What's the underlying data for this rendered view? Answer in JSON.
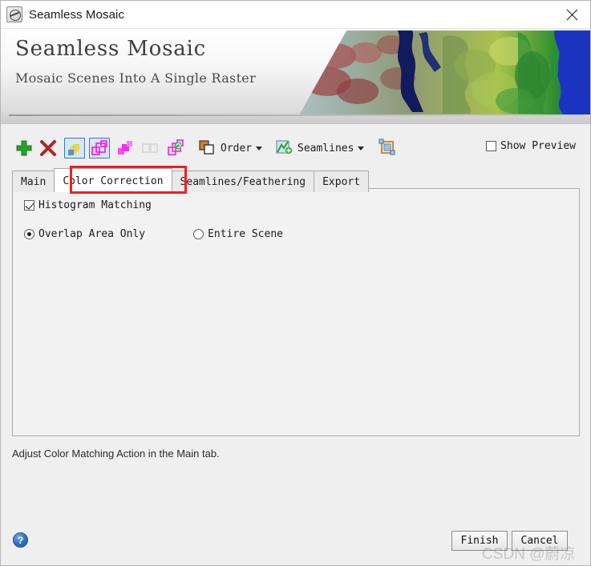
{
  "window": {
    "title": "Seamless Mosaic",
    "app_icon": "seamless-mosaic-app-icon",
    "close_icon": "close-icon"
  },
  "banner": {
    "title": "Seamless Mosaic",
    "subtitle": "Mosaic Scenes Into A Single Raster",
    "image_alt": "satellite-false-color-mosaic"
  },
  "toolbar": {
    "items": [
      {
        "name": "add-scenes-button",
        "icon": "plus-icon",
        "label": "",
        "toggled": false
      },
      {
        "name": "remove-scenes-button",
        "icon": "red-x-icon",
        "label": "",
        "toggled": false
      },
      {
        "name": "show-image-button",
        "icon": "color-image-icon",
        "label": "",
        "toggled": true
      },
      {
        "name": "show-footprints-button",
        "icon": "magenta-outline-frames-icon",
        "label": "",
        "toggled": true
      },
      {
        "name": "show-overlaps-button",
        "icon": "magenta-filled-squares-icon",
        "label": "",
        "toggled": false
      },
      {
        "name": "show-seams-button",
        "icon": "gray-disabled-frames-icon",
        "label": "",
        "toggled": false
      },
      {
        "name": "generate-overview-button",
        "icon": "magenta-green-refresh-frames-icon",
        "label": "",
        "toggled": false
      }
    ],
    "order_menu": {
      "label": "Order",
      "icon": "stacked-squares-icon",
      "caret": "chevron-down-icon"
    },
    "seamlines_menu": {
      "label": "Seamlines",
      "icon": "seamlines-green-icon",
      "caret": "chevron-down-icon"
    },
    "crop_button": {
      "name": "zoom-to-extent-button",
      "icon": "crop-frame-icon"
    },
    "show_preview": {
      "label": "Show Preview",
      "checked": false
    }
  },
  "tabs": [
    {
      "label": "Main",
      "active": false
    },
    {
      "label": "Color Correction",
      "active": true
    },
    {
      "label": "Seamlines/Feathering",
      "active": false
    },
    {
      "label": "Export",
      "active": false
    }
  ],
  "color_correction": {
    "histogram_matching": {
      "label": "Histogram Matching",
      "checked": true
    },
    "scope": {
      "options": [
        {
          "label": "Overlap Area Only",
          "selected": true
        },
        {
          "label": "Entire Scene",
          "selected": false
        }
      ]
    }
  },
  "status": {
    "text": "Adjust Color Matching Action in the Main tab."
  },
  "footer": {
    "help": {
      "label": "?",
      "name": "help-button"
    },
    "finish": "Finish",
    "cancel": "Cancel"
  },
  "annotation": {
    "target": "Color Correction",
    "color": "#f02020"
  },
  "watermark": {
    "text": "CSDN @蔚凉"
  },
  "colors": {
    "dialog_background": "#efefef",
    "panel_background": "#f2f2f2",
    "active_tab_background": "#ffffff",
    "accent_blue": "#3b79b5",
    "annotation_red": "#f02020",
    "plus_green": "#2aa02a",
    "x_red": "#b42222",
    "magenta": "#f21ff2"
  }
}
